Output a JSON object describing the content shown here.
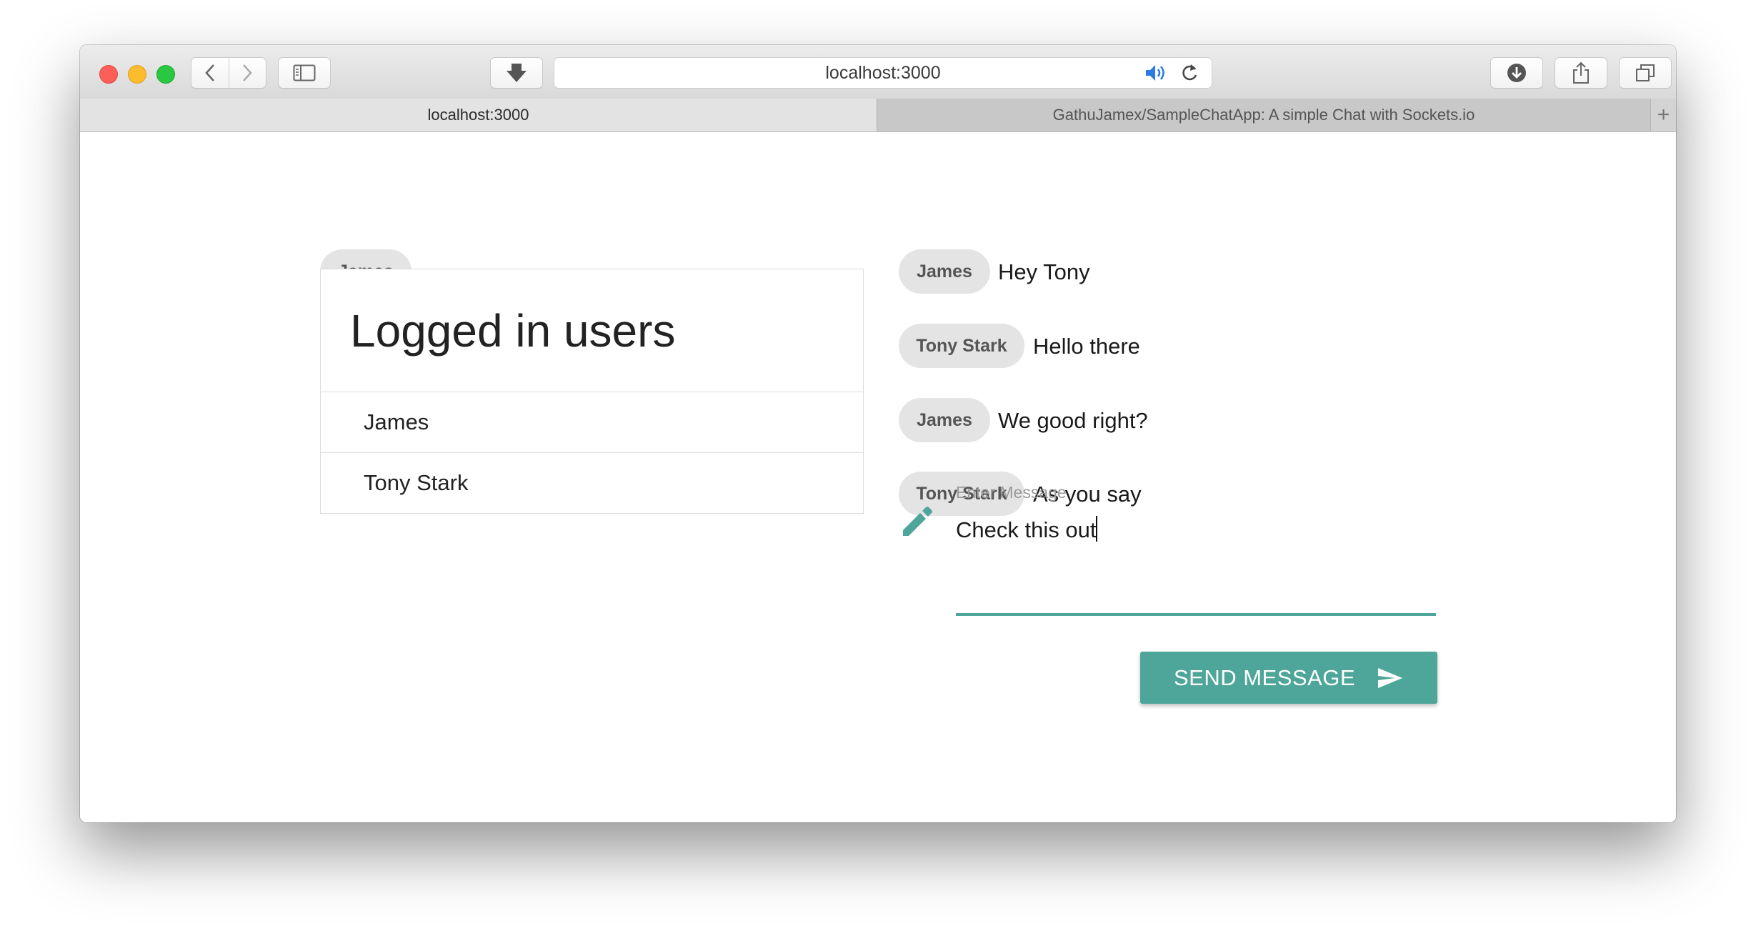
{
  "browser": {
    "url": "localhost:3000",
    "tabs": [
      {
        "label": "localhost:3000",
        "active": true
      },
      {
        "label": "GathuJamex/SampleChatApp: A simple Chat with Sockets.io",
        "active": false
      }
    ],
    "new_tab": "+"
  },
  "sidebar": {
    "current_user": "James",
    "users_title": "Logged in users",
    "users": [
      "James",
      "Tony Stark"
    ]
  },
  "chat": {
    "messages": [
      {
        "user": "James",
        "text": "Hey Tony"
      },
      {
        "user": "Tony Stark",
        "text": "Hello there"
      },
      {
        "user": "James",
        "text": "We good right?"
      },
      {
        "user": "Tony Stark",
        "text": "As you say"
      }
    ],
    "input_label": "Enter Message",
    "input_value": "Check this out",
    "send_label": "SEND MESSAGE"
  },
  "colors": {
    "accent": "#4da699",
    "chip_bg": "#e4e4e4"
  },
  "icons": [
    "back-icon",
    "forward-icon",
    "sidebar-icon",
    "download-arrow-icon",
    "speaker-icon",
    "reload-icon",
    "downloads-icon",
    "share-icon",
    "tabs-icon",
    "pencil-icon",
    "send-icon"
  ]
}
